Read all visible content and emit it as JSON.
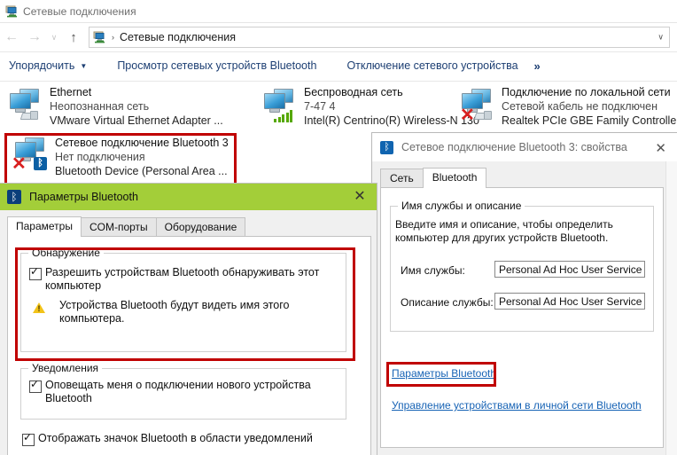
{
  "explorer": {
    "title": "Сетевые подключения",
    "window_icon": "network-connections-icon",
    "nav": {
      "back": "←",
      "forward": "→",
      "recent": "∨",
      "up": "↑"
    },
    "address": {
      "icon": "network-connections-icon",
      "separator": "›",
      "crumb": "Сетевые подключения",
      "dropdown": "∨"
    },
    "toolbar": {
      "organize": "Упорядочить",
      "organize_caret": "▼",
      "view_bt_devices": "Просмотр сетевых устройств Bluetooth",
      "disable_device": "Отключение сетевого устройства",
      "overflow": "»"
    }
  },
  "connections": [
    {
      "name": "Ethernet",
      "status": "Неопознанная сеть",
      "device": "VMware Virtual Ethernet Adapter ...",
      "icons": [
        "monitor-network-icon",
        "network-plug-icon"
      ]
    },
    {
      "name": "Беспроводная сеть",
      "status": "7-47 4",
      "device": "Intel(R) Centrino(R) Wireless-N 130",
      "icons": [
        "monitor-network-icon",
        "wifi-signal-icon"
      ]
    },
    {
      "name": "Подключение по локальной сети",
      "status": "Сетевой кабель не подключен",
      "device": "Realtek PCIe GBE Family Controller",
      "icons": [
        "monitor-network-icon",
        "red-x-icon",
        "network-plug-icon"
      ]
    },
    {
      "name": "Сетевое подключение Bluetooth 3",
      "status": "Нет подключения",
      "device": "Bluetooth Device (Personal Area ...",
      "icons": [
        "monitor-network-icon",
        "red-x-icon",
        "bluetooth-icon"
      ],
      "selected": true
    }
  ],
  "bt_params_window": {
    "icon": "bluetooth-icon",
    "title": "Параметры Bluetooth",
    "close": "✕",
    "tabs": [
      {
        "label": "Параметры",
        "active": true
      },
      {
        "label": "COM-порты",
        "active": false
      },
      {
        "label": "Оборудование",
        "active": false
      }
    ],
    "discovery": {
      "legend": "Обнаружение",
      "checkbox_label": "Разрешить устройствам Bluetooth обнаруживать этот компьютер",
      "checkbox_checked": true,
      "warning_icon": "warning-triangle-icon",
      "warning_text": "Устройства Bluetooth будут видеть имя этого компьютера."
    },
    "notifications": {
      "legend": "Уведомления",
      "checkbox_label": "Оповещать меня о подключении нового устройства Bluetooth",
      "checkbox_checked": true
    },
    "show_icon": {
      "label": "Отображать значок Bluetooth в области уведомлений",
      "checked": true
    }
  },
  "properties_dialog": {
    "icon": "bluetooth-icon",
    "title": "Сетевое подключение Bluetooth 3: свойства",
    "close": "✕",
    "tabs": [
      {
        "label": "Сеть",
        "active": false
      },
      {
        "label": "Bluetooth",
        "active": true
      }
    ],
    "group": {
      "legend": "Имя службы и описание",
      "description": "Введите имя и описание, чтобы определить компьютер для других устройств Bluetooth.",
      "service_name_label": "Имя службы:",
      "service_name_value": "Personal Ad Hoc User Service",
      "service_desc_label": "Описание службы:",
      "service_desc_value": "Personal Ad Hoc User Service"
    },
    "links": [
      {
        "text": "Параметры Bluetooth",
        "highlighted": true
      },
      {
        "text": "Управление устройствами в личной сети Bluetooth",
        "highlighted": false
      }
    ]
  },
  "colors": {
    "highlight_red": "#c00000",
    "green_titlebar": "#a3ce39",
    "link_blue": "#1763b5",
    "toolbar_text": "#1d3f73"
  }
}
